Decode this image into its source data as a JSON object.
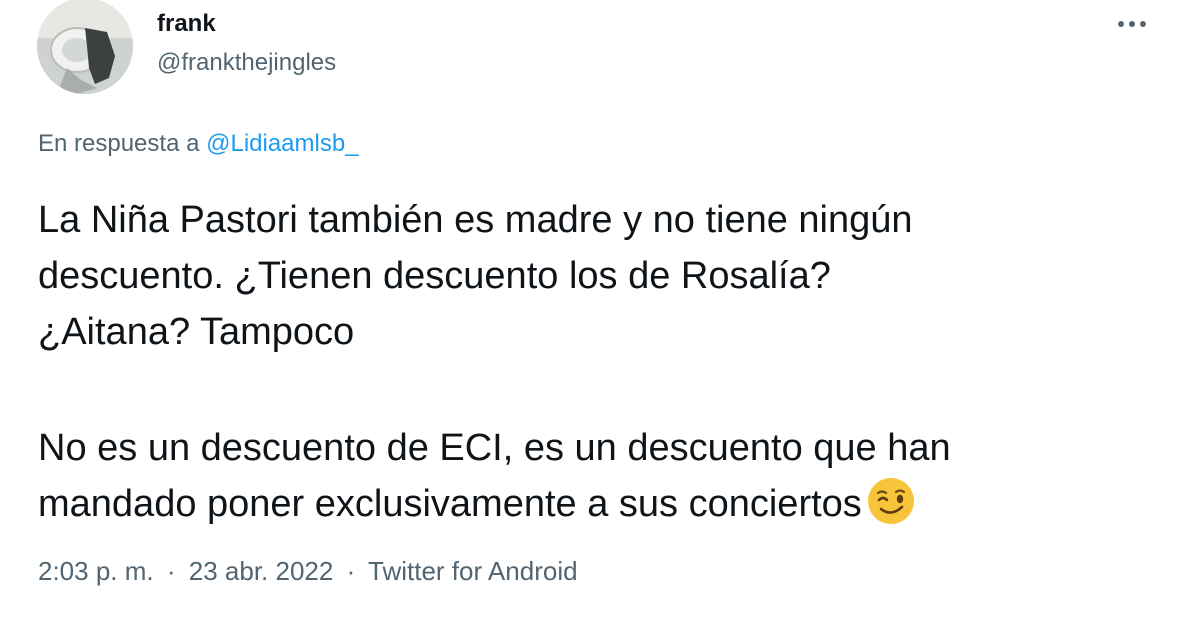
{
  "author": {
    "display_name": "frank",
    "handle": "@frankthejingles",
    "avatar_icon": "avatar-photo"
  },
  "menu": {
    "icon": "more-horizontal-icon"
  },
  "reply": {
    "prefix": "En respuesta a",
    "to_handle": "@Lidiaamlsb_"
  },
  "tweet": {
    "lines": [
      "La Niña Pastori también es madre y no tiene ningún",
      "descuento. ¿Tienen descuento los de Rosalía?",
      "¿Aitana? Tampoco",
      "No es un descuento de ECI, es un descuento que han",
      "mandado poner exclusivamente a sus conciertos"
    ],
    "emoji": "winking-face-emoji"
  },
  "meta": {
    "time": "2:03 p. m.",
    "separator": "·",
    "date": "23 abr. 2022",
    "source": "Twitter for Android"
  },
  "colors": {
    "text": "#0f1419",
    "secondary": "#536471",
    "link": "#1d9bf0",
    "background": "#ffffff"
  }
}
